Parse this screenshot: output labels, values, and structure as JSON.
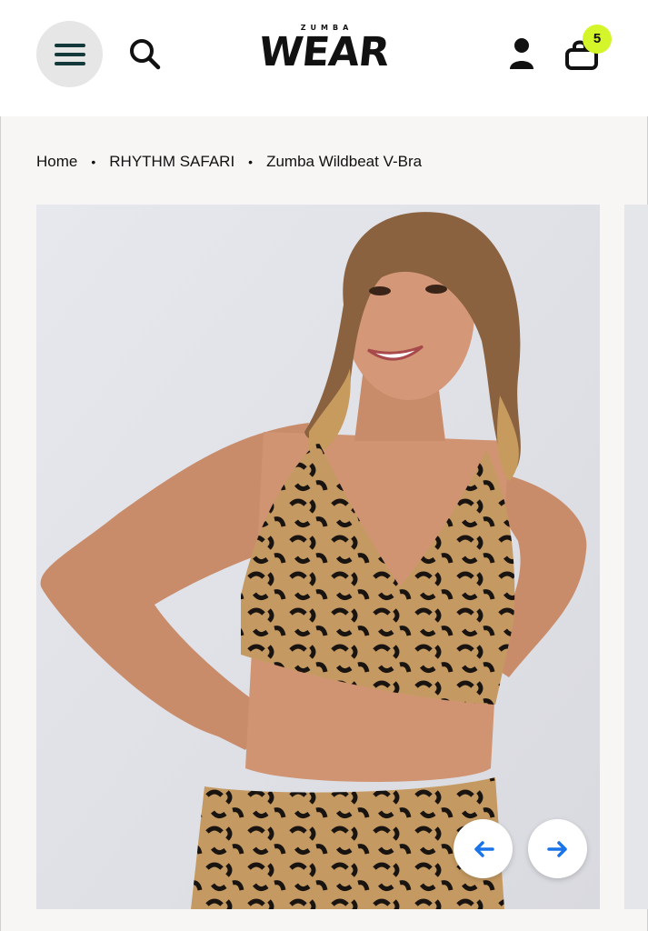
{
  "header": {
    "logo_top": "ZUMBA",
    "logo_main": "WEAR",
    "cart_count": "5",
    "icons": [
      "menu-icon",
      "search-icon",
      "user-icon",
      "shopping-bag-icon"
    ],
    "badge_color": "#d5f52b"
  },
  "breadcrumb": {
    "items": [
      "Home",
      "RHYTHM SAFARI",
      "Zumba Wildbeat V-Bra"
    ],
    "separator": "•"
  },
  "gallery": {
    "image_description": "Model wearing Zumba Wildbeat V-Bra in leopard print",
    "prev_icon": "arrow-left-icon",
    "next_icon": "arrow-right-icon",
    "accent_color": "#1a73e8"
  }
}
